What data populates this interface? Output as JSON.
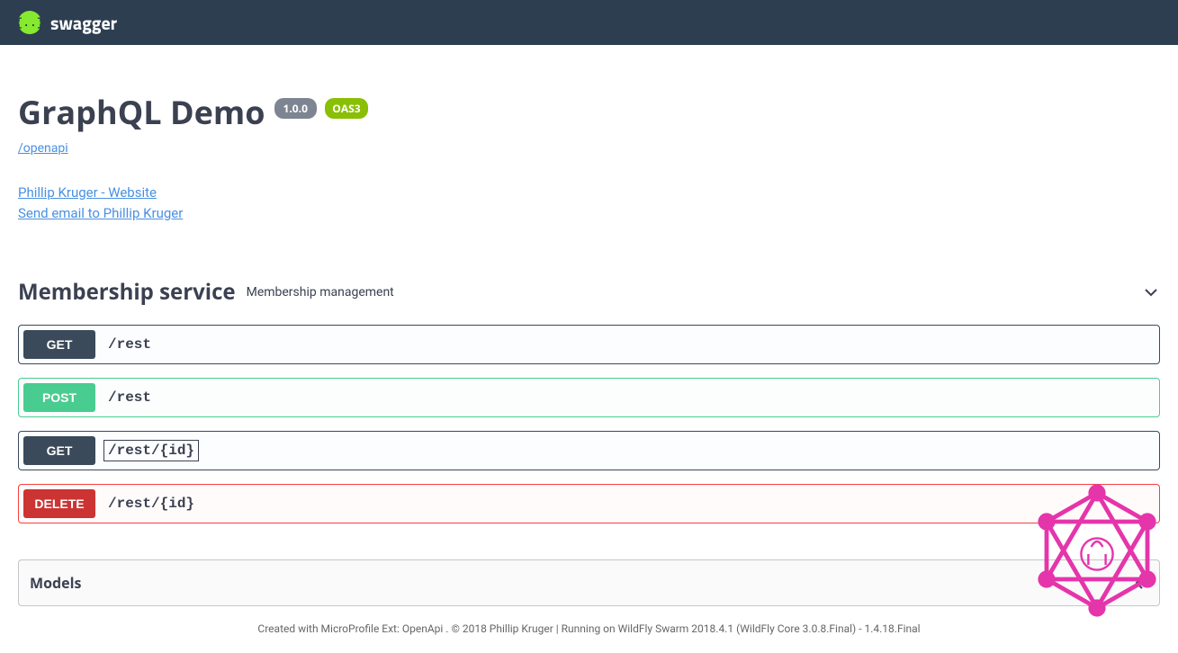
{
  "topbar": {
    "logo_text": "{..}",
    "title": "swagger"
  },
  "info": {
    "title": "GraphQL Demo",
    "version": "1.0.0",
    "oas": "OAS3",
    "base_url": "/openapi",
    "contact_website": "Phillip Kruger - Website",
    "contact_email": "Send email to Phillip Kruger"
  },
  "tag": {
    "name": "Membership service",
    "description": "Membership management"
  },
  "operations": [
    {
      "method": "GET",
      "path": "/rest",
      "method_class": "get"
    },
    {
      "method": "POST",
      "path": "/rest",
      "method_class": "post"
    },
    {
      "method": "GET",
      "path": "/rest/{id}",
      "method_class": "get",
      "outlined": true
    },
    {
      "method": "DELETE",
      "path": "/rest/{id}",
      "method_class": "delete"
    }
  ],
  "models": {
    "title": "Models"
  },
  "footer": {
    "text": "Created with MicroProfile Ext: OpenApi . © 2018 Phillip Kruger | Running on WildFly Swarm 2018.4.1 (WildFly Core 3.0.8.Final) - 1.4.18.Final"
  }
}
